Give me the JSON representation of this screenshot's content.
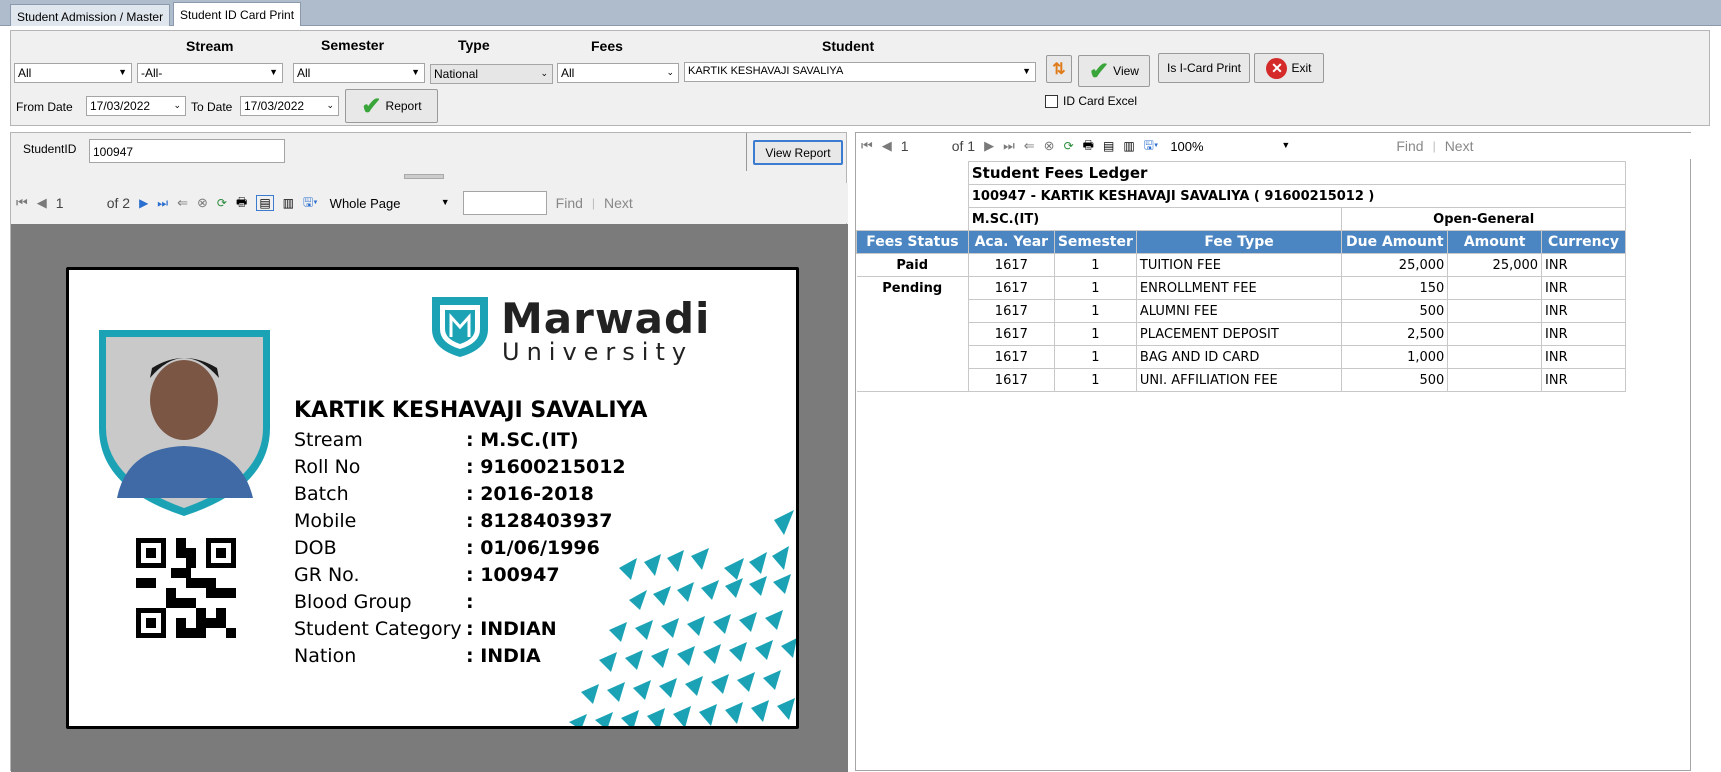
{
  "tabs": [
    {
      "label": "Student Admission / Master"
    },
    {
      "label": "Student ID Card Print"
    }
  ],
  "filters": {
    "stream_label": "Stream",
    "semester_label": "Semester",
    "type_label": "Type",
    "fees_label": "Fees",
    "student_label": "Student",
    "stream_value": "All",
    "stream2_value": "-All-",
    "semester_value": "All",
    "type_value": "National",
    "fees_value": "All",
    "student_value": "KARTIK KESHAVAJI SAVALIYA",
    "from_date_label": "From Date",
    "from_date": "17/03/2022",
    "to_date_label": "To Date",
    "to_date": "17/03/2022",
    "report_btn": "Report",
    "view_btn": "View",
    "icard_btn": "Is I-Card Print",
    "exit_btn": "Exit",
    "id_card_excel_label": "ID Card Excel"
  },
  "left": {
    "student_id_label": "StudentID",
    "student_id_value": "100947",
    "view_report_btn": "View Report",
    "toolbar": {
      "page": "1",
      "of_pages": "of 2",
      "zoom": "Whole Page",
      "find": "Find",
      "next": "Next"
    },
    "card": {
      "logo_top": "Marwadi",
      "logo_bottom": "University",
      "name": "KARTIK KESHAVAJI SAVALIYA",
      "fields": [
        {
          "label": "Stream",
          "value": ": M.SC.(IT)"
        },
        {
          "label": "Roll No",
          "value": ": 91600215012"
        },
        {
          "label": "Batch",
          "value": ": 2016-2018"
        },
        {
          "label": "Mobile",
          "value": ": 8128403937"
        },
        {
          "label": "DOB",
          "value": ": 01/06/1996"
        },
        {
          "label": "GR No.",
          "value": ": 100947"
        },
        {
          "label": "Blood Group",
          "value": ":"
        },
        {
          "label": "Student Category",
          "value": ": INDIAN"
        },
        {
          "label": "Nation",
          "value": ": INDIA"
        }
      ],
      "accent_color": "#1ba3b5"
    }
  },
  "right": {
    "toolbar": {
      "page": "1",
      "of_pages": "of 1",
      "zoom": "100%",
      "find": "Find",
      "next": "Next"
    },
    "report": {
      "title": "Student Fees Ledger",
      "student_line": "100947 - KARTIK KESHAVAJI SAVALIYA  ( 91600215012 )",
      "course": "M.SC.(IT)",
      "category": "Open-General",
      "headers": [
        "Fees Status",
        "Aca. Year",
        "Semester",
        "Fee Type",
        "Due Amount",
        "Amount",
        "Currency"
      ],
      "rows": [
        {
          "status": "Paid",
          "year": "1617",
          "sem": "1",
          "fee": "TUITION FEE",
          "due": "25,000",
          "amount": "25,000",
          "cur": "INR"
        },
        {
          "status": "Pending",
          "year": "1617",
          "sem": "1",
          "fee": "ENROLLMENT FEE",
          "due": "150",
          "amount": "",
          "cur": "INR"
        },
        {
          "status": "",
          "year": "1617",
          "sem": "1",
          "fee": "ALUMNI FEE",
          "due": "500",
          "amount": "",
          "cur": "INR"
        },
        {
          "status": "",
          "year": "1617",
          "sem": "1",
          "fee": "PLACEMENT DEPOSIT",
          "due": "2,500",
          "amount": "",
          "cur": "INR"
        },
        {
          "status": "",
          "year": "1617",
          "sem": "1",
          "fee": "BAG AND ID CARD",
          "due": "1,000",
          "amount": "",
          "cur": "INR"
        },
        {
          "status": "",
          "year": "1617",
          "sem": "1",
          "fee": "UNI. AFFILIATION FEE",
          "due": "500",
          "amount": "",
          "cur": "INR"
        }
      ],
      "header_color": "#4b86c2"
    }
  }
}
